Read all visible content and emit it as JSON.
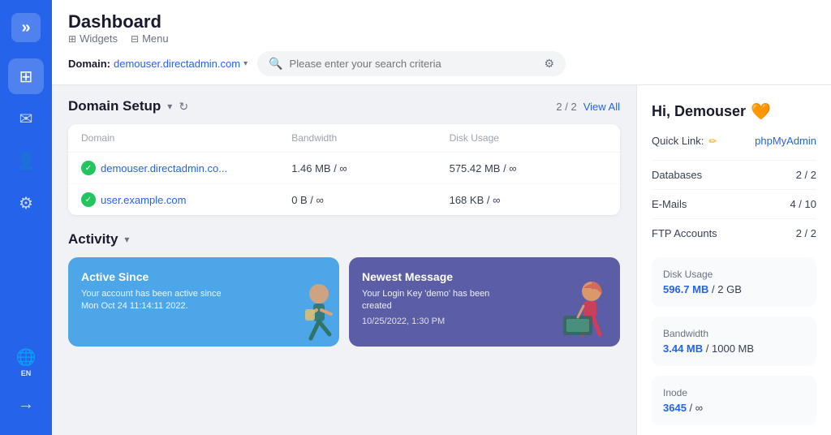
{
  "sidebar": {
    "logo": "»",
    "items": [
      {
        "id": "apps",
        "icon": "⊞",
        "label": ""
      },
      {
        "id": "messages",
        "icon": "💬",
        "label": ""
      },
      {
        "id": "users",
        "icon": "👤",
        "label": ""
      },
      {
        "id": "settings",
        "icon": "⚙",
        "label": ""
      },
      {
        "id": "globe",
        "icon": "🌐",
        "label": "EN"
      }
    ],
    "bottom_items": [
      {
        "id": "logout",
        "icon": "→",
        "label": ""
      }
    ]
  },
  "header": {
    "title": "Dashboard",
    "nav": [
      {
        "id": "widgets",
        "icon": "⊞",
        "label": "Widgets"
      },
      {
        "id": "menu",
        "icon": "⊟",
        "label": "Menu"
      }
    ],
    "domain_label": "Domain:",
    "domain_value": "demouser.directadmin.com",
    "search_placeholder": "Please enter your search criteria"
  },
  "domain_setup": {
    "title": "Domain Setup",
    "count": "2 / 2",
    "view_all": "View All",
    "columns": [
      "Domain",
      "Bandwidth",
      "Disk Usage"
    ],
    "rows": [
      {
        "domain": "demouser.directadmin.co...",
        "bandwidth": "1.46 MB / ∞",
        "disk_usage": "575.42 MB / ∞",
        "active": true
      },
      {
        "domain": "user.example.com",
        "bandwidth": "0 B / ∞",
        "disk_usage": "168 KB / ∞",
        "active": true
      }
    ]
  },
  "activity": {
    "title": "Activity",
    "cards": [
      {
        "id": "active-since",
        "color": "blue",
        "title": "Active Since",
        "text": "Your account has been active since Mon Oct 24 11:14:11 2022.",
        "illustration": "🏃"
      },
      {
        "id": "newest-message",
        "color": "purple",
        "title": "Newest Message",
        "text": "Your Login Key 'demo' has been created",
        "date": "10/25/2022, 1:30 PM",
        "illustration": "📖"
      }
    ]
  },
  "right_panel": {
    "greeting": "Hi, Demouser",
    "emoji": "🧡",
    "quick_link": {
      "label": "Quick Link:",
      "value": "phpMyAdmin"
    },
    "stats": [
      {
        "label": "Databases",
        "value": "2 / 2"
      },
      {
        "label": "E-Mails",
        "value": "4 / 10"
      },
      {
        "label": "FTP Accounts",
        "value": "2 / 2"
      }
    ],
    "usage": [
      {
        "label": "Disk Usage",
        "number": "596.7 MB",
        "separator": " / ",
        "total": "2 GB"
      },
      {
        "label": "Bandwidth",
        "number": "3.44 MB",
        "separator": " / ",
        "total": "1000 MB"
      },
      {
        "label": "Inode",
        "number": "3645",
        "separator": " / ",
        "total": "∞"
      }
    ]
  }
}
